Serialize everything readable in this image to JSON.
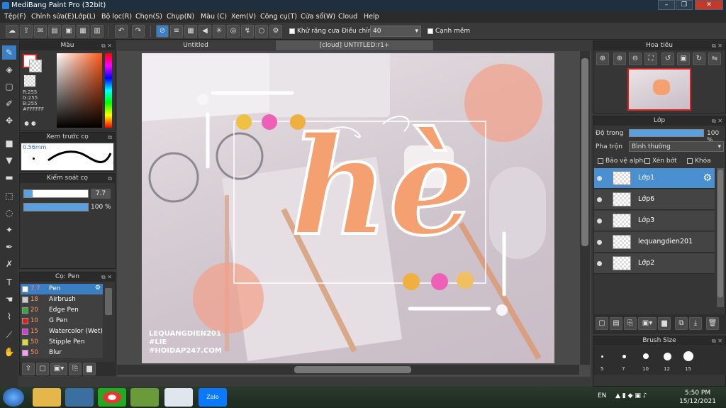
{
  "window": {
    "title": "MediBang Paint Pro (32bit)",
    "watermark_tab": "Tiu Thread"
  },
  "menu": [
    "Tệp(F)",
    "Chỉnh sửa(E)",
    "Lớp(L)",
    "Bộ lọc(R)",
    "Chọn(S)",
    "Chụp(N)",
    "Màu (C)",
    "Xem(V)",
    "Công cụ(T)",
    "Cửa sổ(W)",
    "Cloud",
    "Help"
  ],
  "toolbar": {
    "antialias": "Khử răng cưa",
    "adjust": "Điều chỉnh",
    "adjust_value": "40",
    "snap": "Cạnh mềm"
  },
  "color_panel": {
    "title": "Màu",
    "r": "R:255",
    "g": "G:255",
    "b": "B:255",
    "hex": "#FFFFFF"
  },
  "brush_preview": {
    "title": "Xem trước cọ",
    "size": "0.56mm"
  },
  "brush_control": {
    "title": "Kiểm soát cọ",
    "size": "7.7",
    "opacity": "100 %",
    "opacity_pct": 100
  },
  "brush_list": {
    "title": "Cọ: Pen",
    "items": [
      {
        "size": "7.7",
        "name": "Pen",
        "color": "#ffffff",
        "selected": true
      },
      {
        "size": "18",
        "name": "Airbrush",
        "color": "#cccccc"
      },
      {
        "size": "20",
        "name": "Edge Pen",
        "color": "#33aa33"
      },
      {
        "size": "10",
        "name": "G Pen",
        "color": "#dd2222"
      },
      {
        "size": "15",
        "name": "Watercolor (Wet)",
        "color": "#dd33dd"
      },
      {
        "size": "50",
        "name": "Stipple Pen",
        "color": "#dddd22"
      },
      {
        "size": "50",
        "name": "Blur",
        "color": "#ff99ff"
      }
    ]
  },
  "tabs": {
    "untitled": "Untitled",
    "cloud": "[cloud] UNTITLED:r1+"
  },
  "artwork": {
    "big_text": "hè",
    "watermark": [
      "LEQUANGDIEN201",
      "#LIE",
      "#HOIDAP247.COM"
    ]
  },
  "navigator": {
    "title": "Hoa tiêu"
  },
  "layer_panel": {
    "title": "Lớp",
    "opacity_label": "Độ trong",
    "opacity_value": "100 %",
    "blend_label": "Pha trộn",
    "blend_value": "Bình thường",
    "protect_alpha": "Bảo vệ alpha",
    "clipping": "Xén bớt",
    "lock": "Khóa",
    "layers": [
      {
        "name": "Lớp1",
        "selected": true
      },
      {
        "name": "Lớp6"
      },
      {
        "name": "Lớp3"
      },
      {
        "name": "lequangdien201"
      },
      {
        "name": "Lớp2"
      }
    ]
  },
  "brush_size": {
    "title": "Brush Size",
    "sizes": [
      "5",
      "7",
      "10",
      "12",
      "15"
    ]
  },
  "taskbar": {
    "lang": "EN",
    "time": "5:50 PM",
    "date": "15/12/2021"
  }
}
